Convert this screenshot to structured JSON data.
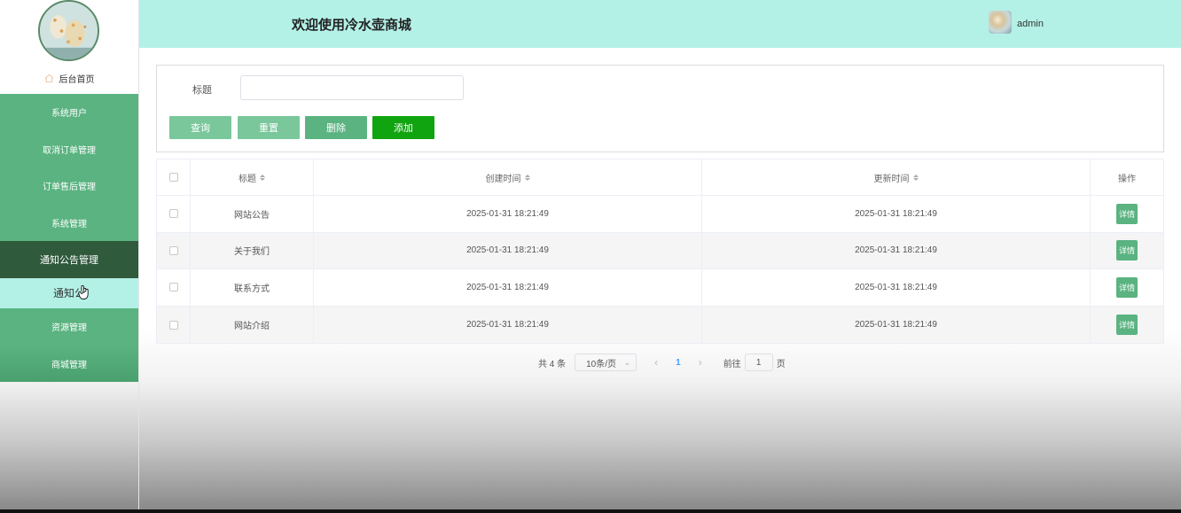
{
  "header": {
    "title": "欢迎使用冷水壶商城",
    "username": "admin"
  },
  "sidebar": {
    "home_label": "后台首页",
    "items": [
      {
        "label": "系统用户"
      },
      {
        "label": "取消订单管理"
      },
      {
        "label": "订单售后管理"
      },
      {
        "label": "系统管理"
      },
      {
        "label": "通知公告管理",
        "active": true
      },
      {
        "label": "通知公",
        "submenu": true
      },
      {
        "label": "资源管理"
      },
      {
        "label": "商城管理"
      }
    ]
  },
  "search": {
    "title_label": "标题",
    "title_value": "",
    "buttons": {
      "query": "查询",
      "reset": "重置",
      "delete": "删除",
      "add": "添加"
    }
  },
  "table": {
    "columns": {
      "title": "标题",
      "created": "创建时间",
      "updated": "更新时间",
      "op": "操作"
    },
    "rows": [
      {
        "title": "网站公告",
        "created": "2025-01-31 18:21:49",
        "updated": "2025-01-31 18:21:49",
        "action": "详情"
      },
      {
        "title": "关于我们",
        "created": "2025-01-31 18:21:49",
        "updated": "2025-01-31 18:21:49",
        "action": "详情"
      },
      {
        "title": "联系方式",
        "created": "2025-01-31 18:21:49",
        "updated": "2025-01-31 18:21:49",
        "action": "详情"
      },
      {
        "title": "网站介绍",
        "created": "2025-01-31 18:21:49",
        "updated": "2025-01-31 18:21:49",
        "action": "详情"
      }
    ]
  },
  "pagination": {
    "total": "共 4 条",
    "page_size": "10条/页",
    "current_page": "1",
    "goto_prefix": "前往",
    "goto_value": "1",
    "goto_suffix": "页"
  },
  "colors": {
    "header_bg": "#b3f1e7",
    "menu_bg": "#5ab380",
    "menu_active_bg": "#2f5a3c",
    "add_button": "#11a411",
    "page_active": "#409eff"
  }
}
